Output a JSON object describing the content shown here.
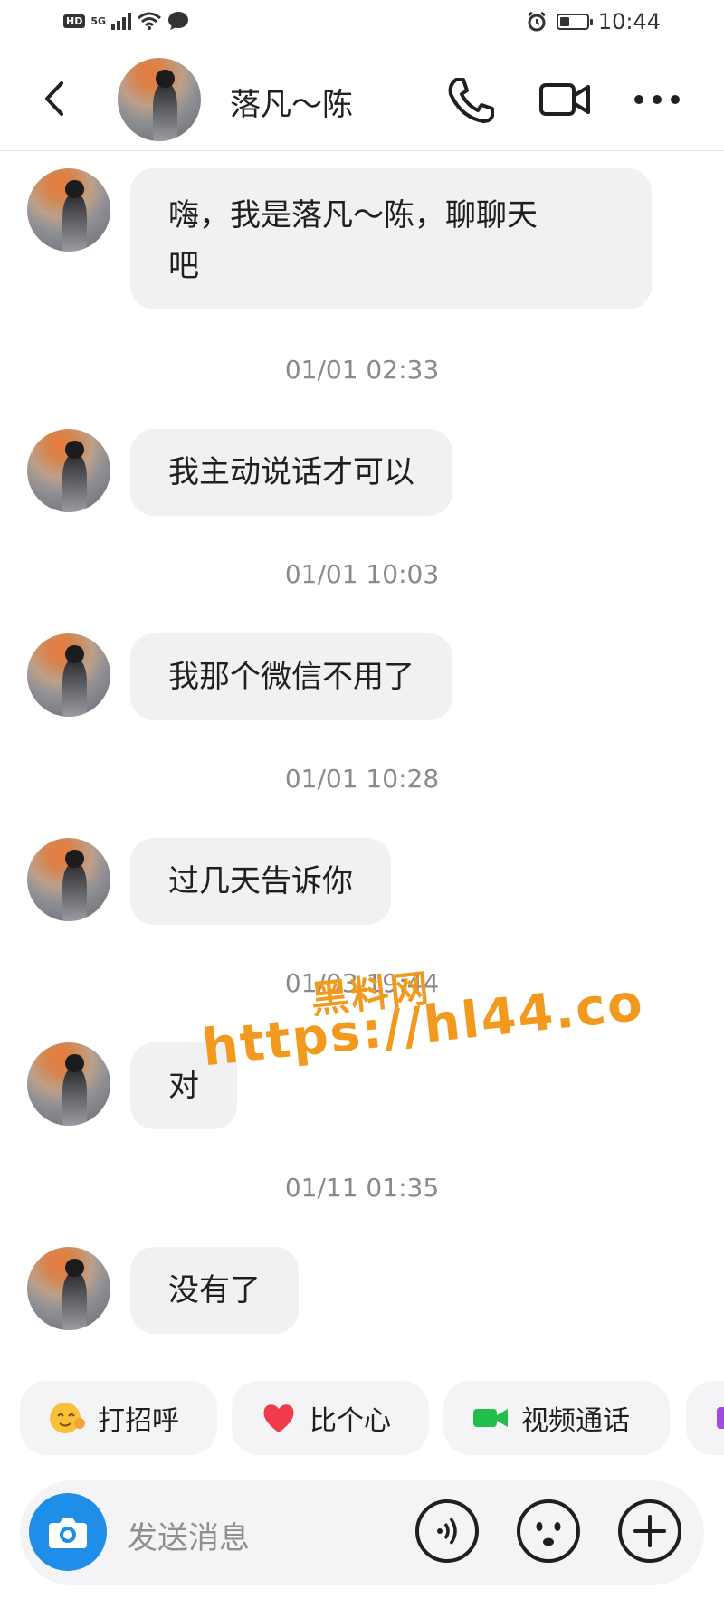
{
  "status_bar": {
    "network_badge": "HD",
    "network_type": "5G",
    "time": "10:44",
    "battery_level": 0.35
  },
  "header": {
    "contact_name": "落凡～陈",
    "icons": [
      "back-arrow-icon",
      "phone-icon",
      "video-call-icon",
      "more-dots-icon"
    ]
  },
  "messages": [
    {
      "text": "嗨，我是落凡～陈，聊聊天吧",
      "line1": "嗨，我是落凡～陈，聊聊天",
      "line2": "吧"
    },
    {
      "time": "01/01 02:33",
      "text": "我主动说话才可以"
    },
    {
      "time": "01/01 10:03",
      "text": "我那个微信不用了"
    },
    {
      "time": "01/01 10:28",
      "text": "过几天告诉你"
    },
    {
      "time": "01/03 19:44",
      "text": "对"
    },
    {
      "time": "01/11 01:35",
      "text": "没有了"
    }
  ],
  "watermark": {
    "line1": "黑料网",
    "line2": "https://hl44.co"
  },
  "quick_actions": [
    {
      "label": "打招呼",
      "icon": "wave-emoji-icon"
    },
    {
      "label": "比个心",
      "icon": "heart-icon"
    },
    {
      "label": "视频通话",
      "icon": "video-camera-icon"
    }
  ],
  "input": {
    "placeholder": "发送消息",
    "icons": [
      "camera-icon",
      "voice-icon",
      "emoji-icon",
      "plus-icon"
    ]
  },
  "colors": {
    "bubble": "#f1f1f3",
    "camera_button": "#1e8ee8",
    "watermark": "#f29a1e",
    "heart": "#ef3b4a",
    "video_green": "#1fbf4a"
  }
}
